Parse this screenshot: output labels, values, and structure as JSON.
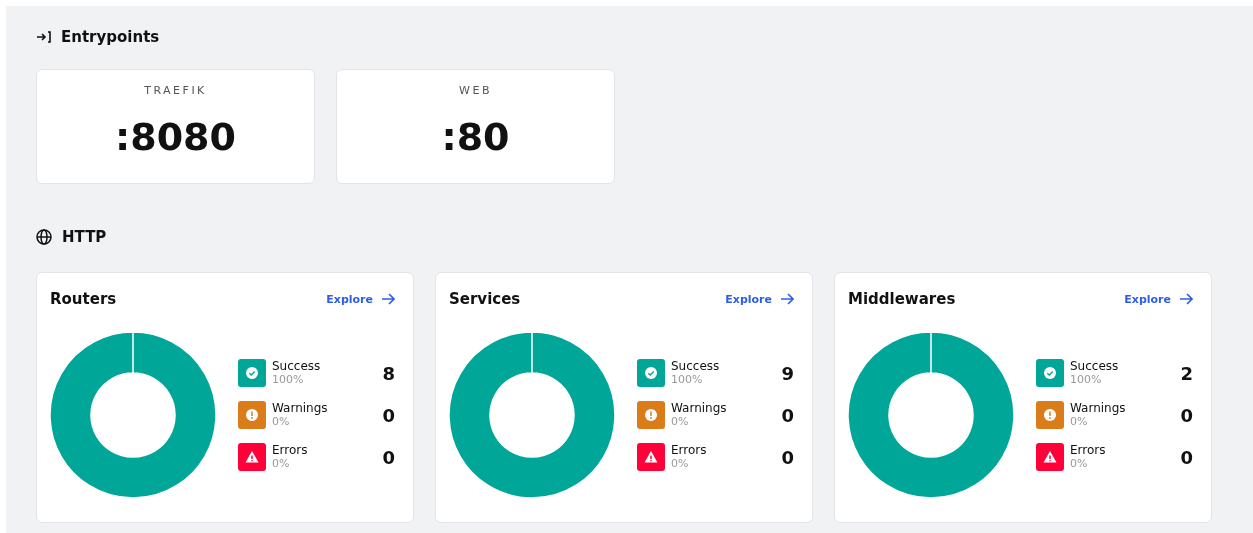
{
  "entrypoints": {
    "title": "Entrypoints",
    "items": [
      {
        "name": "TRAEFIK",
        "address": ":8080"
      },
      {
        "name": "WEB",
        "address": ":80"
      }
    ]
  },
  "http": {
    "title": "HTTP",
    "cards": [
      {
        "title": "Routers",
        "link": "Explore",
        "stats": [
          {
            "kind": "success",
            "label": "Success",
            "percent": "100%",
            "count": "8",
            "color": "#00a697"
          },
          {
            "kind": "warning",
            "label": "Warnings",
            "percent": "0%",
            "count": "0",
            "color": "#db7c1a"
          },
          {
            "kind": "error",
            "label": "Errors",
            "percent": "0%",
            "count": "0",
            "color": "#ff0039"
          }
        ]
      },
      {
        "title": "Services",
        "link": "Explore",
        "stats": [
          {
            "kind": "success",
            "label": "Success",
            "percent": "100%",
            "count": "9",
            "color": "#00a697"
          },
          {
            "kind": "warning",
            "label": "Warnings",
            "percent": "0%",
            "count": "0",
            "color": "#db7c1a"
          },
          {
            "kind": "error",
            "label": "Errors",
            "percent": "0%",
            "count": "0",
            "color": "#ff0039"
          }
        ]
      },
      {
        "title": "Middlewares",
        "link": "Explore",
        "stats": [
          {
            "kind": "success",
            "label": "Success",
            "percent": "100%",
            "count": "2",
            "color": "#00a697"
          },
          {
            "kind": "warning",
            "label": "Warnings",
            "percent": "0%",
            "count": "0",
            "color": "#db7c1a"
          },
          {
            "kind": "error",
            "label": "Errors",
            "percent": "0%",
            "count": "0",
            "color": "#ff0039"
          }
        ]
      }
    ]
  }
}
